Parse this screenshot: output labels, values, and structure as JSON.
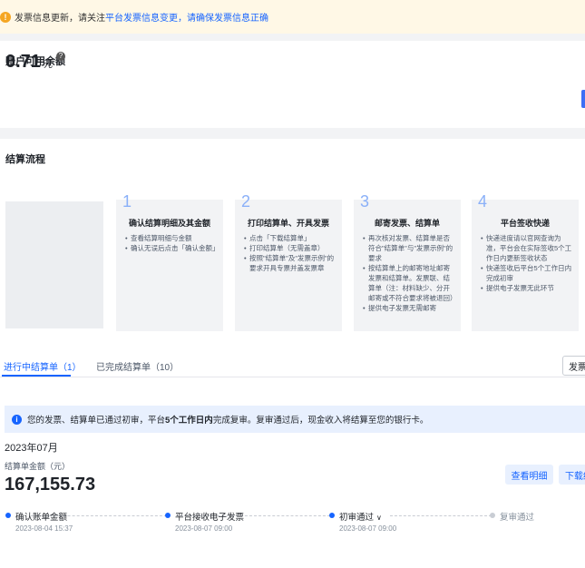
{
  "notice": {
    "text": "发票信息更新，请关注",
    "link": "平台发票信息变更，请确保发票信息正确"
  },
  "balance": {
    "title": "账户可用余额",
    "amount": "0.71",
    "unit": "元"
  },
  "flow": {
    "title": "结算流程",
    "steps": [
      {
        "number": "1",
        "title": "确认结算明细及其金额",
        "items": [
          "查看结算明细与金额",
          "确认无误后点击「确认金额」"
        ]
      },
      {
        "number": "2",
        "title": "打印结算单、开具发票",
        "items": [
          "点击「下载结算单」",
          "打印结算单（无需盖章）",
          "按照\"结算单\"及\"发票示例\"的要求开具专票并盖发票章"
        ]
      },
      {
        "number": "3",
        "title": "邮寄发票、结算单",
        "items": [
          "再次核对发票、结算单是否符合\"结算单\"与\"发票示例\"的要求",
          "按结算单上的邮寄地址邮寄发票和结算单。发票联、结算单（注：材料缺少、分开邮寄或不符合要求将被退回）",
          "提供电子发票无需邮寄"
        ]
      },
      {
        "number": "4",
        "title": "平台签收快递",
        "items": [
          "快递进度请以官网查询为准，平台会在实际签收5个工作日内更新签收状态",
          "快递签收后平台5个工作日内完成初审",
          "提供电子发票无此环节"
        ]
      }
    ]
  },
  "tabs": {
    "active": "进行中结算单（1）",
    "inactive": "已完成结算单（10）",
    "right_button": "发票"
  },
  "info": {
    "prefix": "您的发票、结算单已通过初审，平台",
    "bold": "5个工作日内",
    "suffix": "完成复审。复审通过后，现金收入将结算至您的银行卡。"
  },
  "settlement": {
    "month": "2023年07月",
    "amount_label": "结算单金额（元）",
    "amount": "167,155.73",
    "view_detail": "查看明细",
    "download": "下载结"
  },
  "timeline": [
    {
      "label": "确认账单金额",
      "date": "2023-08-04 15:37",
      "state": "done"
    },
    {
      "label": "平台接收电子发票",
      "date": "2023-08-07 09:00",
      "state": "done"
    },
    {
      "label": "初审通过",
      "date": "2023-08-07 09:00",
      "state": "done"
    },
    {
      "label": "复审通过",
      "date": "",
      "state": "pending"
    }
  ],
  "colors": {
    "primary": "#1664ff",
    "warning": "#f5a623",
    "notice_bg": "#fff8e6",
    "info_bg": "#e8f0fe"
  }
}
